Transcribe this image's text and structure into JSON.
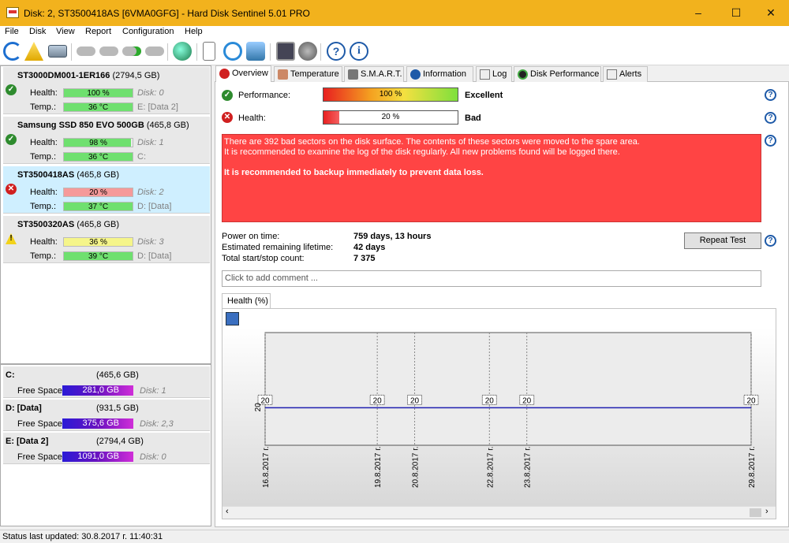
{
  "window": {
    "title": "Disk: 2, ST3500418AS [6VMA0GFG]  -  Hard Disk Sentinel 5.01 PRO",
    "minimize": "–",
    "maximize": "☐",
    "close": "✕"
  },
  "menu": [
    "File",
    "Disk",
    "View",
    "Report",
    "Configuration",
    "Help"
  ],
  "toolbar_icons": [
    "refresh-icon",
    "warning-icon",
    "drive-icon",
    "tool-icon",
    "tool2-icon",
    "tool3-icon",
    "tool4-icon",
    "globe-icon",
    "report-icon",
    "sync-icon",
    "network-icon",
    "test-icon",
    "sound-icon",
    "help-icon",
    "info-icon"
  ],
  "disks": [
    {
      "name": "ST3000DM001-1ER166",
      "size": "(2794,5 GB)",
      "health_label": "Health:",
      "health": "100 %",
      "health_pct": 100,
      "health_color": "#6fe06f",
      "temp_label": "Temp.:",
      "temp": "36 °C",
      "disk_no": "Disk: 0",
      "volume": "E: [Data 2]",
      "status": "ok"
    },
    {
      "name": "Samsung SSD 850 EVO 500GB",
      "size": "(465,8 GB)",
      "health_label": "Health:",
      "health": "98 %",
      "health_pct": 98,
      "health_color": "#6fe06f",
      "temp_label": "Temp.:",
      "temp": "36 °C",
      "disk_no": "Disk: 1",
      "volume": "C:",
      "status": "ok"
    },
    {
      "name": "ST3500418AS",
      "size": "(465,8 GB)",
      "health_label": "Health:",
      "health": "20 %",
      "health_pct": 100,
      "health_color": "#f59a9a",
      "temp_label": "Temp.:",
      "temp": "37 °C",
      "disk_no": "Disk: 2",
      "volume": "D: [Data]",
      "status": "bad"
    },
    {
      "name": "ST3500320AS",
      "size": "(465,8 GB)",
      "health_label": "Health:",
      "health": "36 %",
      "health_pct": 100,
      "health_color": "#f5f58a",
      "temp_label": "Temp.:",
      "temp": "39 °C",
      "disk_no": "Disk: 3",
      "volume": "D: [Data]",
      "status": "warn"
    }
  ],
  "volumes": [
    {
      "name": "C:",
      "size": "(465,6 GB)",
      "free_label": "Free Space",
      "free": "281,0 GB",
      "disks": "Disk: 1"
    },
    {
      "name": "D: [Data]",
      "size": "(931,5 GB)",
      "free_label": "Free Space",
      "free": "375,6 GB",
      "disks": "Disk: 2,3"
    },
    {
      "name": "E: [Data 2]",
      "size": "(2794,4 GB)",
      "free_label": "Free Space",
      "free": "1091,0 GB",
      "disks": "Disk: 0"
    }
  ],
  "tabs": [
    "Overview",
    "Temperature",
    "S.M.A.R.T.",
    "Information",
    "Log",
    "Disk Performance",
    "Alerts"
  ],
  "overview": {
    "performance_label": "Performance:",
    "performance_value": "100 %",
    "performance_rating": "Excellent",
    "health_label": "Health:",
    "health_value": "20 %",
    "health_pct": 20,
    "health_rating": "Bad",
    "alert_line1": "There are 392 bad sectors on the disk surface. The contents of these sectors were moved to the spare area.",
    "alert_line2": "It is recommended to examine the log of the disk regularly. All new problems found will be logged there.",
    "alert_line3": "It is recommended to backup immediately to prevent data loss.",
    "power_on_label": "Power on time:",
    "power_on_value": "759 days, 13 hours",
    "remaining_label": "Estimated remaining lifetime:",
    "remaining_value": "42 days",
    "startstop_label": "Total start/stop count:",
    "startstop_value": "7 375",
    "repeat_test": "Repeat Test",
    "comment_placeholder": "Click to add comment ...",
    "help_glyph": "?"
  },
  "chart_tab": "Health (%)",
  "chart_data": {
    "type": "line",
    "x": [
      "16.8.2017 г.",
      "19.8.2017 г.",
      "20.8.2017 г.",
      "22.8.2017 г.",
      "23.8.2017 г.",
      "29.8.2017 г."
    ],
    "x_days": [
      16,
      19,
      20,
      22,
      23,
      29
    ],
    "values": [
      20,
      20,
      20,
      20,
      20,
      20
    ],
    "y_tick": "20",
    "ylim": [
      0,
      60
    ],
    "grid": true
  },
  "statusbar": "Status last updated: 30.8.2017 г. 11:40:31"
}
